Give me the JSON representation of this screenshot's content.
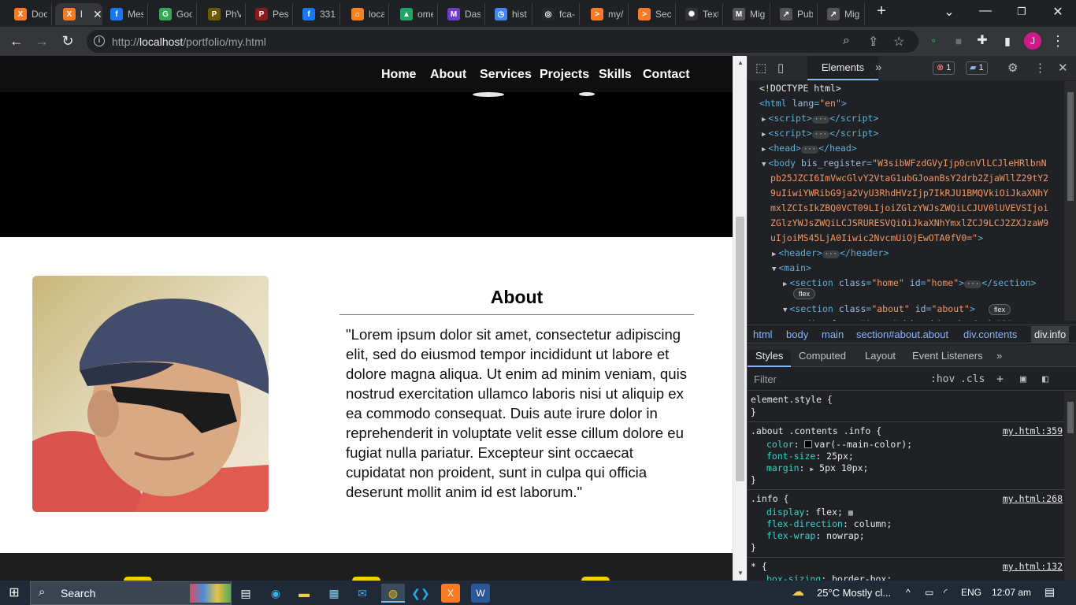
{
  "tabs": [
    {
      "title": "Doc",
      "icon": "xampp-icon",
      "color": "#fb7a24",
      "glyph": "X"
    },
    {
      "title": "l",
      "icon": "xampp-icon",
      "color": "#fb7a24",
      "glyph": "X",
      "active": true
    },
    {
      "title": "Mes",
      "icon": "facebook-icon",
      "color": "#1877f2",
      "glyph": "f"
    },
    {
      "title": "Goo",
      "icon": "google-icon",
      "color": "#34a853",
      "glyph": "G"
    },
    {
      "title": "PhV",
      "icon": "phv-icon",
      "color": "#6b5b00",
      "glyph": "P"
    },
    {
      "title": "Pese",
      "icon": "pese-icon",
      "color": "#8b1a1a",
      "glyph": "P"
    },
    {
      "title": "331",
      "icon": "facebook-icon",
      "color": "#1877f2",
      "glyph": "f"
    },
    {
      "title": "loca",
      "icon": "localhost-icon",
      "color": "#f5821f",
      "glyph": "⌂"
    },
    {
      "title": "ome",
      "icon": "drive-icon",
      "color": "#1fa463",
      "glyph": "▲"
    },
    {
      "title": "Das",
      "icon": "dashboard-icon",
      "color": "#6e40c9",
      "glyph": "M"
    },
    {
      "title": "hist",
      "icon": "history-icon",
      "color": "#4285f4",
      "glyph": "◷"
    },
    {
      "title": "fca-",
      "icon": "github-icon",
      "color": "#24292e",
      "glyph": "◎"
    },
    {
      "title": "my/",
      "icon": "xampp-icon",
      "color": "#fb7a24",
      "glyph": ">"
    },
    {
      "title": "Sec",
      "icon": "xampp-icon",
      "color": "#fb7a24",
      "glyph": ">"
    },
    {
      "title": "Text",
      "icon": "openai-icon",
      "color": "#333333",
      "glyph": "✺"
    },
    {
      "title": "Mig",
      "icon": "mig-icon",
      "color": "#555555",
      "glyph": "M"
    },
    {
      "title": "Pub",
      "icon": "pub-icon",
      "color": "#555555",
      "glyph": "↗"
    },
    {
      "title": "Mig",
      "icon": "pub-icon",
      "color": "#555555",
      "glyph": "↗"
    }
  ],
  "browser": {
    "url_scheme": "http://",
    "url_host": "localhost",
    "url_path": "/portfolio/my.html",
    "profile_initial": "J"
  },
  "site": {
    "nav": [
      "Home",
      "About",
      "Services",
      "Projects",
      "Skills",
      "Contact"
    ],
    "about_title": "About",
    "about_text": "\"Lorem ipsum dolor sit amet, consectetur adipiscing elit, sed do eiusmod tempor incididunt ut labore et dolore magna aliqua. Ut enim ad minim veniam, quis nostrud exercitation ullamco laboris nisi ut aliquip ex ea commodo consequat. Duis aute irure dolor in reprehenderit in voluptate velit esse cillum dolore eu fugiat nulla pariatur. Excepteur sint occaecat cupidatat non proident, sunt in culpa qui officia deserunt mollit anim id est laborum.\""
  },
  "devtools": {
    "active_tab": "Elements",
    "errors": "1",
    "messages": "1",
    "body_attr_value": "W3sibWFzdGVyIjp0cnVlLCJleHRlbnNpb25JZCI6ImVwcGlvY2VtaG1ubGJoanBsY2drb2ZjaWllZ29tY29uIiwiYWRibG9ja2VyU3RhdHVzIjp7IkRJU1BMQVkiOiJkaXNhYmxlZCIsIkZBQ0VCT09LIjoiZGlzYWJsZWQiLCJUV0lUVEVSIjoiZGlzYWJsZWQiLCJSRURESVQiOiJkaXNhYmxlZCJ9LCJ2ZXJzaW9uIjoiMS45LjA0Iiwic2NvcmUiOjEwOTA0fV0=",
    "breadcrumbs": [
      "html",
      "body",
      "main",
      "section#about.about",
      "div.contents",
      "div.info"
    ],
    "styles_tabs": [
      "Styles",
      "Computed",
      "Layout",
      "Event Listeners"
    ],
    "filter_placeholder": "Filter",
    "hov": ":hov",
    "cls": ".cls",
    "rules": [
      {
        "selector": "element.style {",
        "source": ""
      },
      {
        "selector": ".about .contents .info {",
        "source": "my.html:359",
        "props": [
          [
            "color",
            "var(--main-color);"
          ],
          [
            "font-size",
            "25px;"
          ],
          [
            "margin",
            "5px 10px;"
          ]
        ]
      },
      {
        "selector": ".info {",
        "source": "my.html:268",
        "props": [
          [
            "display",
            "flex;"
          ],
          [
            "flex-direction",
            "column;"
          ],
          [
            "flex-wrap",
            "nowrap;"
          ]
        ]
      },
      {
        "selector": "* {",
        "source": "my.html:132",
        "props": [
          [
            "box-sizing",
            "border-box;"
          ]
        ]
      }
    ]
  },
  "taskbar": {
    "search_label": "Search",
    "weather": "25°C  Mostly cl...",
    "lang": "ENG",
    "time": "12:07 am"
  }
}
